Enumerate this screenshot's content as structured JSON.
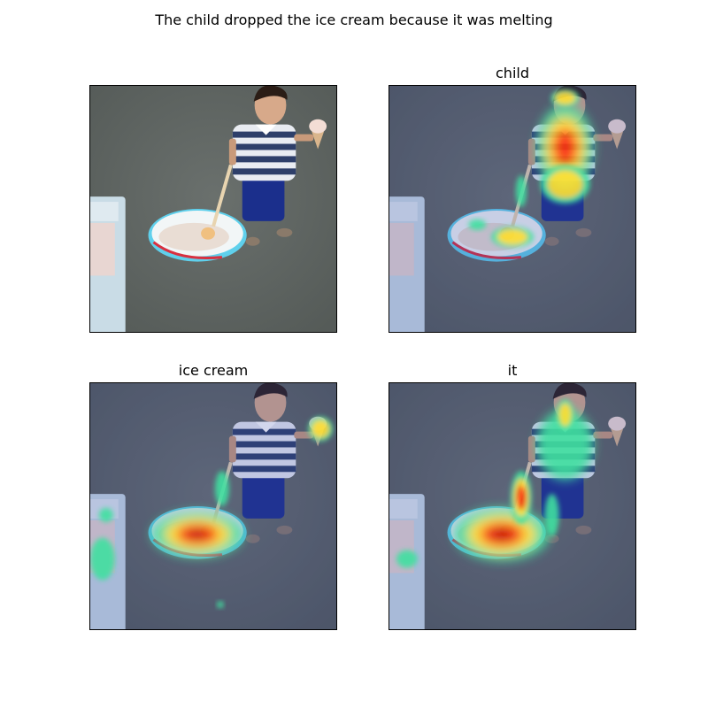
{
  "figure": {
    "title": "The child dropped the ice cream because it was melting",
    "panels": [
      {
        "title": "",
        "content": "original photo"
      },
      {
        "title": "child",
        "content": "attention heatmap over child"
      },
      {
        "title": "ice cream",
        "content": "attention heatmap over ice cream bowl"
      },
      {
        "title": "it",
        "content": "attention heatmap over bowl and child"
      }
    ]
  },
  "colors": {
    "ground": "#5d6360",
    "bowl": "#5fd0ec",
    "shirt_stripe": "#2e3f6a",
    "shorts": "#1b2f8c",
    "tint_overlay": "#3344aa",
    "heat_low": "#40e0a0",
    "heat_mid": "#ffe030",
    "heat_high": "#ff3010",
    "heat_peak": "#c00000"
  }
}
